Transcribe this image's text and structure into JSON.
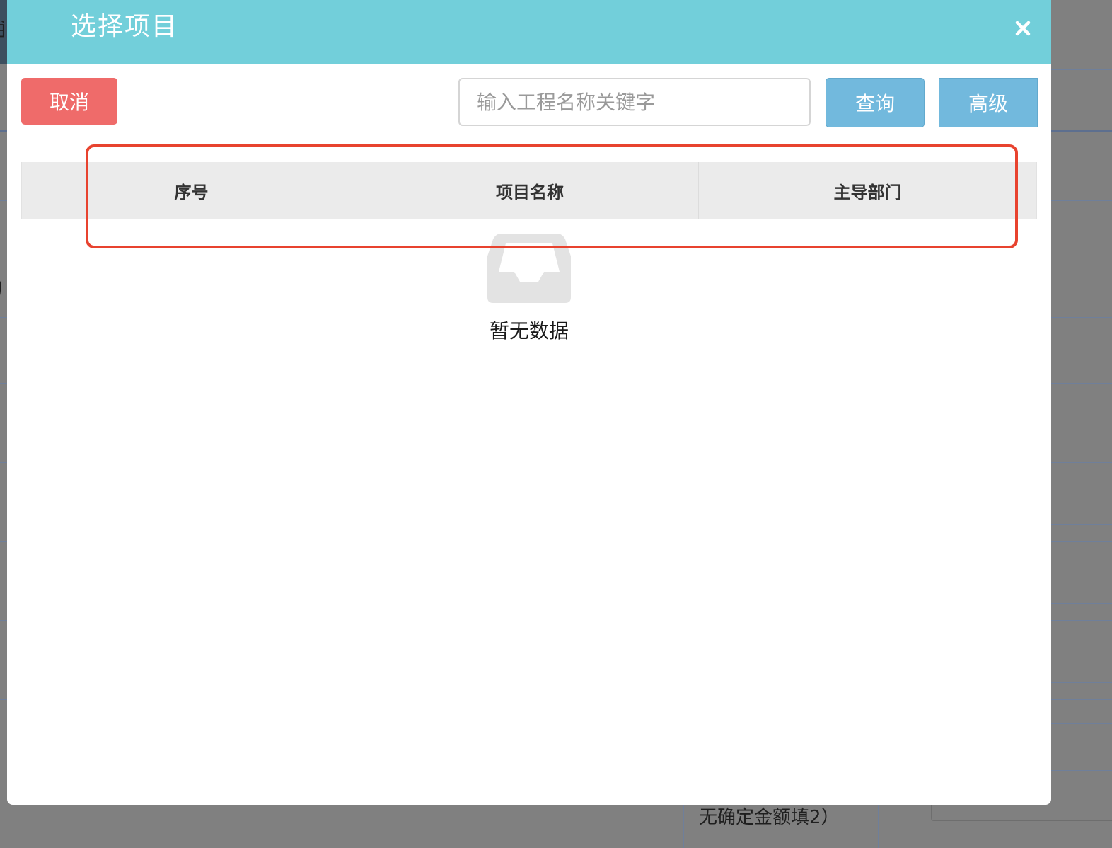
{
  "background": {
    "footnote_text": "无确定金额填2）",
    "left_edge_glyph_1": "主",
    "left_edge_glyph_2": "训"
  },
  "dialog": {
    "title": "选择项目",
    "close_icon": "close-icon",
    "cancel_label": "取消",
    "search": {
      "placeholder": "输入工程名称关键字",
      "value": ""
    },
    "query_label": "查询",
    "advanced_label": "高级",
    "table": {
      "columns": [
        "序号",
        "项目名称",
        "主导部门"
      ],
      "rows": []
    },
    "empty_icon": "inbox-icon",
    "empty_text": "暂无数据"
  },
  "annotation": {
    "color": "#e8432f"
  },
  "colors": {
    "header": "#72cfda",
    "cancel": "#ef6b6a",
    "primary": "#72b9dd"
  }
}
